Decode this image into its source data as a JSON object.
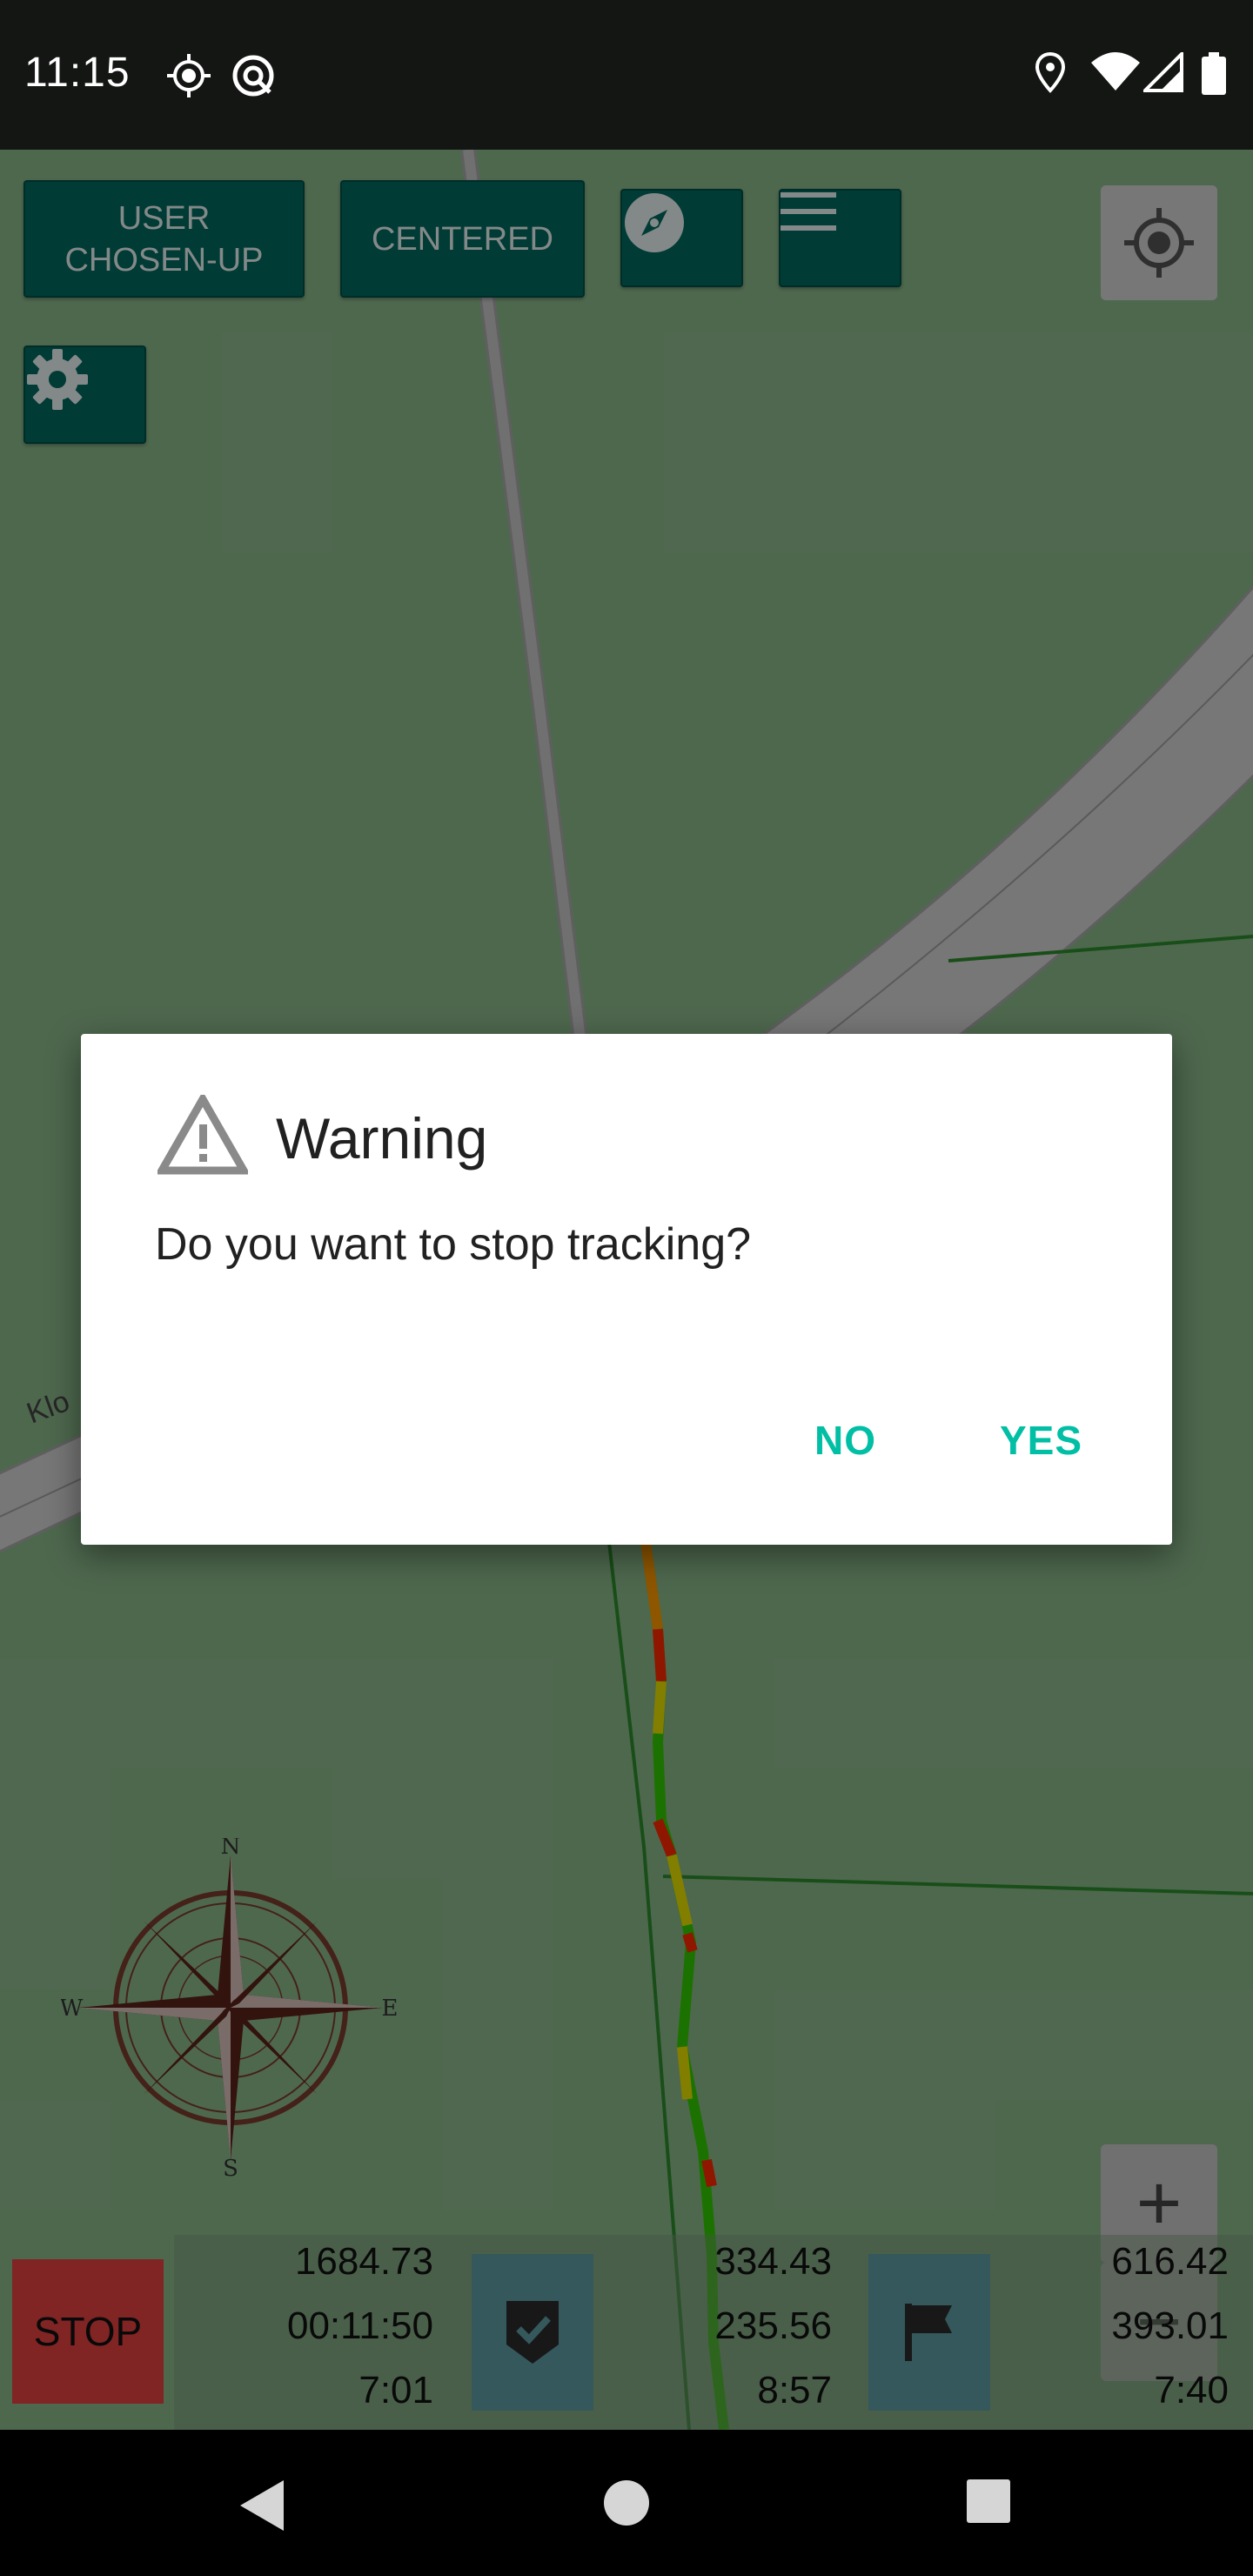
{
  "status_bar": {
    "time": "11:15",
    "icons_left": [
      "gps-icon",
      "sync-icon"
    ],
    "icons_right": [
      "location-pin-icon",
      "wifi-icon",
      "cell-signal-icon",
      "battery-icon"
    ]
  },
  "map": {
    "road_label": "Klo",
    "top_buttons": {
      "orientation_label": "USER\nCHOSEN-UP",
      "centered_label": "CENTERED",
      "compass_icon": "compass-icon",
      "menu_icon": "menu-icon",
      "settings_icon": "gear-icon",
      "locate_icon": "crosshair-icon"
    },
    "zoom": {
      "in_label": "+",
      "out_label": "−"
    },
    "compass_rose": {
      "north": "N",
      "south": "S",
      "east": "E",
      "west": "W",
      "ticks": [
        "15",
        "30",
        "45",
        "60",
        "75",
        "105",
        "120",
        "135",
        "150",
        "165",
        "195",
        "210",
        "225",
        "240",
        "255",
        "285",
        "300",
        "315",
        "330",
        "345"
      ]
    }
  },
  "bottom_panel": {
    "stop_label": "STOP",
    "col1": [
      "1684.73",
      "00:11:50",
      "7:01"
    ],
    "col2": [
      "334.43",
      "235.56",
      "8:57"
    ],
    "col3": [
      "616.42",
      "393.01",
      "7:40"
    ],
    "checkmark_icon": "checkmark-shield-icon",
    "flag_icon": "flag-icon"
  },
  "dialog": {
    "title": "Warning",
    "icon": "warning-triangle-icon",
    "message": "Do you want to stop tracking?",
    "no_label": "NO",
    "yes_label": "YES",
    "accent_color": "#00bfa5"
  },
  "nav_bar": {
    "back": "back-triangle-icon",
    "home": "home-circle-icon",
    "recents": "recents-square-icon"
  }
}
